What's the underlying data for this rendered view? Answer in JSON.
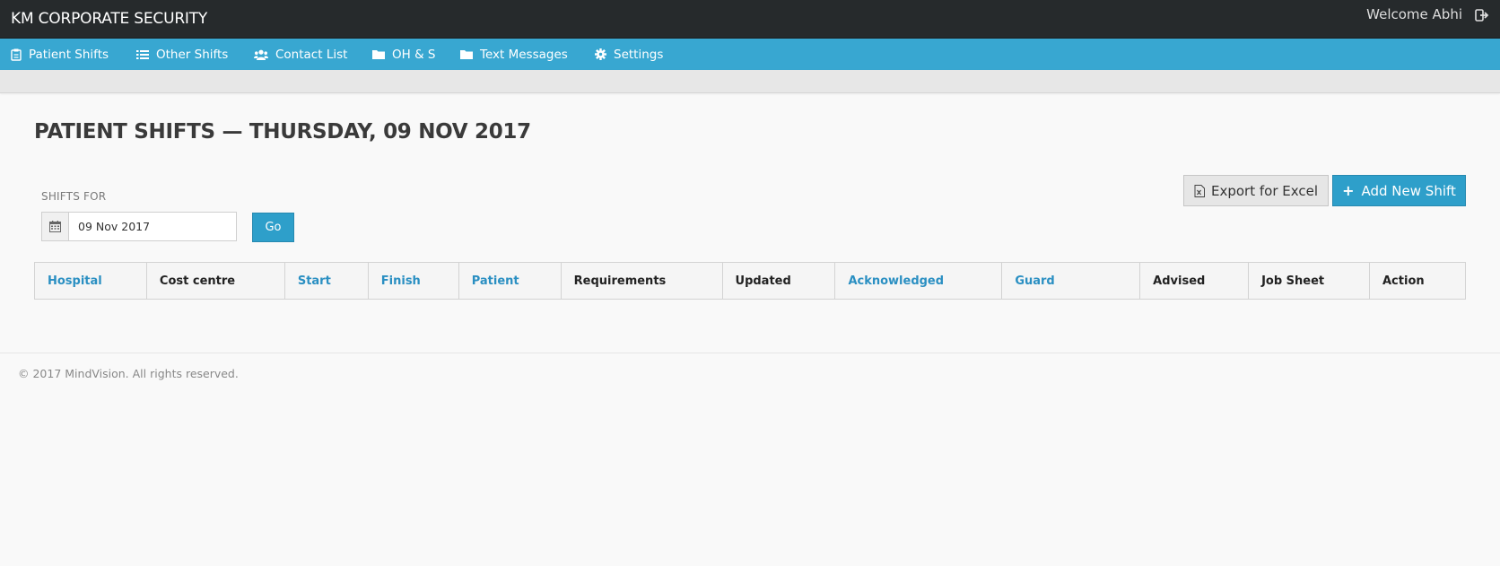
{
  "header": {
    "brand": "KM CORPORATE SECURITY",
    "welcome": "Welcome Abhi",
    "logout_icon": "sign-out-icon"
  },
  "nav": {
    "items": [
      {
        "label": "Patient Shifts",
        "icon": "clipboard-icon"
      },
      {
        "label": "Other Shifts",
        "icon": "list-icon"
      },
      {
        "label": "Contact List",
        "icon": "users-icon"
      },
      {
        "label": "OH & S",
        "icon": "folder-icon"
      },
      {
        "label": "Text Messages",
        "icon": "folder-icon"
      },
      {
        "label": "Settings",
        "icon": "gear-icon"
      }
    ]
  },
  "page": {
    "title": "PATIENT SHIFTS — THURSDAY, 09 NOV 2017"
  },
  "filter": {
    "label": "SHIFTS FOR",
    "date_value": "09 Nov 2017",
    "go_label": "Go"
  },
  "actions": {
    "export_label": "Export for Excel",
    "add_label": "Add New Shift",
    "add_prefix": "+"
  },
  "table": {
    "columns": [
      {
        "label": "Hospital",
        "sortable": true
      },
      {
        "label": "Cost centre",
        "sortable": false
      },
      {
        "label": "Start",
        "sortable": true
      },
      {
        "label": "Finish",
        "sortable": true
      },
      {
        "label": "Patient",
        "sortable": true
      },
      {
        "label": "Requirements",
        "sortable": false
      },
      {
        "label": "Updated",
        "sortable": false
      },
      {
        "label": "Acknowledged",
        "sortable": true
      },
      {
        "label": "Guard",
        "sortable": true
      },
      {
        "label": "Advised",
        "sortable": false
      },
      {
        "label": "Job Sheet",
        "sortable": false
      },
      {
        "label": "Action",
        "sortable": false
      }
    ]
  },
  "footer": {
    "text": "© 2017 MindVision. All rights reserved."
  },
  "colors": {
    "topbar": "#262a2c",
    "nav": "#38a7d1",
    "primary_button": "#2e9fca",
    "link": "#2a8fc2"
  }
}
